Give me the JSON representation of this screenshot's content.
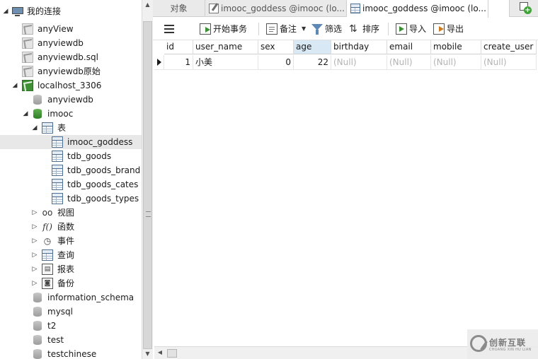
{
  "tree": {
    "root_label": "我的连接",
    "connections": [
      "anyView",
      "anyviewdb",
      "anyviewdb.sql",
      "anyviewdb原始"
    ],
    "server_label": "localhost_3306",
    "databases_before": [
      "anyviewdb"
    ],
    "open_database": "imooc",
    "tables_group": "表",
    "tables": [
      "imooc_goddess",
      "tdb_goods",
      "tdb_goods_brand",
      "tdb_goods_cates",
      "tdb_goods_types"
    ],
    "selected_table": "imooc_goddess",
    "groups": [
      "视图",
      "函数",
      "事件",
      "查询",
      "报表",
      "备份"
    ],
    "databases_after": [
      "information_schema",
      "mysql",
      "t2",
      "test",
      "testchinese"
    ]
  },
  "tabs": [
    {
      "label": "对象",
      "icon": "objects-tab"
    },
    {
      "label": "imooc_goddess @imooc (lo...",
      "icon": "edit-table-icon"
    },
    {
      "label": "imooc_goddess @imooc (lo...",
      "icon": "table-icon"
    }
  ],
  "toolbar": {
    "begin_transaction": "开始事务",
    "note": "备注",
    "filter": "筛选",
    "sort": "排序",
    "import": "导入",
    "export": "导出"
  },
  "grid": {
    "columns": [
      "id",
      "user_name",
      "sex",
      "age",
      "birthday",
      "email",
      "mobile",
      "create_user"
    ],
    "sorted_column": "age",
    "rows": [
      [
        "1",
        "小美",
        "0",
        "22",
        "(Null)",
        "(Null)",
        "(Null)",
        "(Null)"
      ]
    ]
  },
  "watermark": {
    "text": "创新互联",
    "sub": "CHUANG XIN HU LIAN"
  }
}
